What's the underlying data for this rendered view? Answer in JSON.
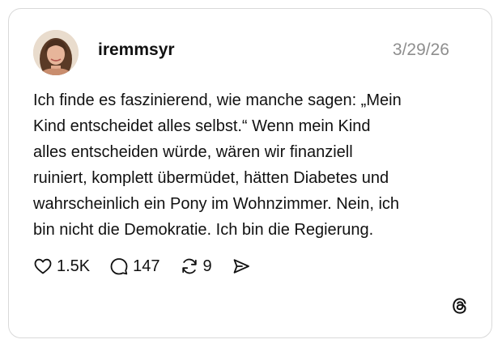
{
  "post": {
    "username": "iremmsyr",
    "date": "3/29/26",
    "text_lines": [
      "Ich finde es faszinierend, wie manche sagen: „Mein",
      "Kind entscheidet alles selbst.“ Wenn mein Kind",
      "alles entscheiden würde, wären wir finanziell",
      "ruiniert, komplett übermüdet, hätten Diabetes und",
      "wahrscheinlich ein Pony im Wohnzimmer. Nein, ich",
      "bin nicht die Demokratie. Ich bin die Regierung."
    ]
  },
  "actions": {
    "likes": "1.5K",
    "comments": "147",
    "reposts": "9"
  },
  "icons": {
    "like": "heart-icon",
    "comment": "comment-bubble-icon",
    "repost": "repost-icon",
    "share": "send-icon",
    "brand": "threads-logo-icon"
  },
  "colors": {
    "text": "#111111",
    "muted": "#8e8e8e",
    "border": "#d9d9d9"
  }
}
